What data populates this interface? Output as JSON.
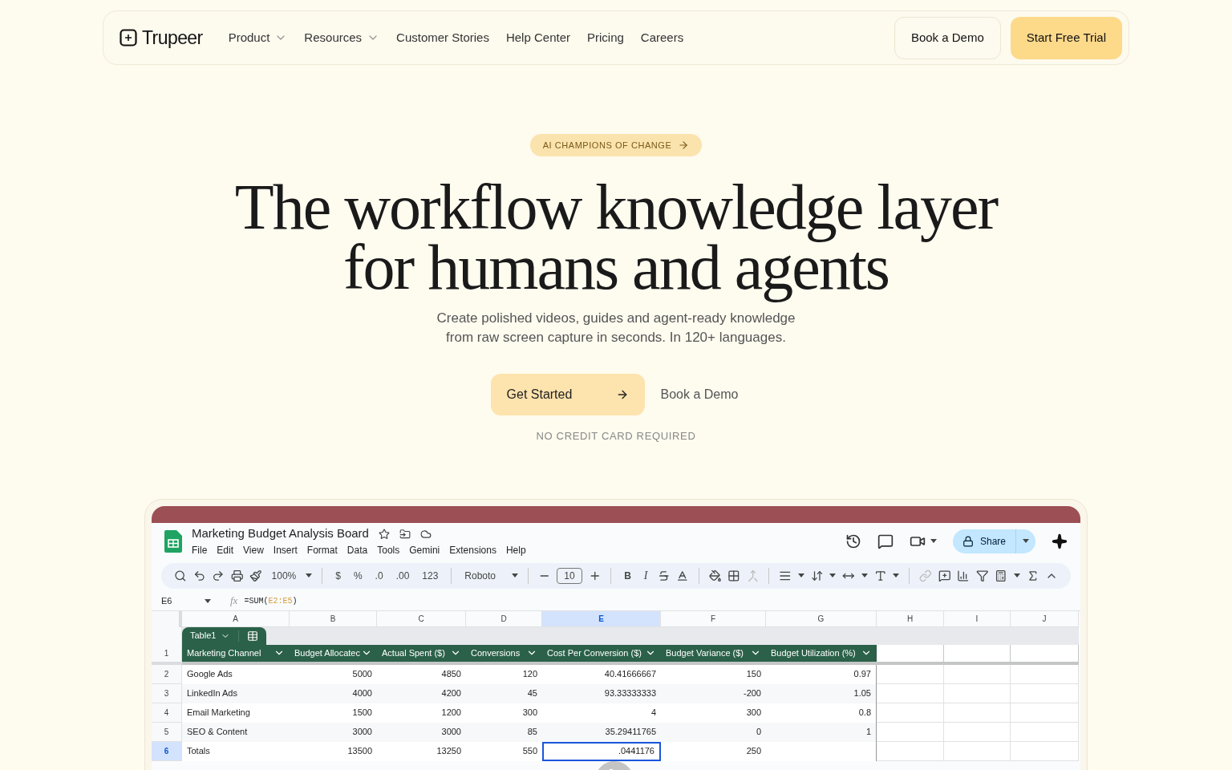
{
  "nav": {
    "logo": "Trupeer",
    "links": [
      {
        "label": "Product",
        "dropdown": true
      },
      {
        "label": "Resources",
        "dropdown": true
      },
      {
        "label": "Customer Stories",
        "dropdown": false
      },
      {
        "label": "Help Center",
        "dropdown": false
      },
      {
        "label": "Pricing",
        "dropdown": false
      },
      {
        "label": "Careers",
        "dropdown": false
      }
    ],
    "buttons": [
      {
        "label": "Book a Demo",
        "kind": "outline"
      },
      {
        "label": "Start Free Trial",
        "kind": "primary"
      }
    ]
  },
  "hero": {
    "badge": "AI CHAMPIONS OF CHANGE",
    "headline": [
      "The workflow knowledge layer",
      "for humans and agents"
    ],
    "subtitle": [
      "Create polished videos, guides and agent-ready knowledge",
      "from raw screen capture in seconds. In 120+ languages."
    ],
    "cta": [
      {
        "label": "Get Started",
        "kind": "primary"
      },
      {
        "label": "Book a Demo",
        "kind": "link"
      }
    ],
    "note": "NO CREDIT CARD REQUIRED"
  },
  "spreadsheet": {
    "title": "Marketing Budget Analysis Board",
    "menus": [
      "File",
      "Edit",
      "View",
      "Insert",
      "Format",
      "Data",
      "Tools",
      "Gemini",
      "Extensions",
      "Help"
    ],
    "share": "Share",
    "toolbar": {
      "zoom": "100%",
      "currency": "$",
      "percent": "%",
      "decrease_decimal": ".0",
      "increase_decimal": ".00",
      "number_format": "123",
      "font": "Roboto",
      "font_size": "10",
      "bold": "B",
      "italic": "I"
    },
    "cell_ref": "E6",
    "function_label": "fx",
    "formula": {
      "prefix": "=SUM(",
      "range": "E2:E5",
      "suffix": ")"
    },
    "columns": [
      {
        "label": "A",
        "selected": false
      },
      {
        "label": "B",
        "selected": false
      },
      {
        "label": "C",
        "selected": false
      },
      {
        "label": "D",
        "selected": false
      },
      {
        "label": "E",
        "selected": true
      },
      {
        "label": "F",
        "selected": false
      },
      {
        "label": "G",
        "selected": false
      },
      {
        "label": "H",
        "selected": false
      },
      {
        "label": "I",
        "selected": false
      },
      {
        "label": "J",
        "selected": false
      }
    ],
    "table_name": "Table1",
    "header": {
      "number": "1",
      "cells": [
        "Marketing Channel",
        "Budget Allocatec",
        "Actual Spent ($)",
        "Conversions",
        "Cost Per Conversion ($)",
        "Budget Variance ($)",
        "Budget Utilization (%)"
      ]
    },
    "rows": [
      {
        "number": "2",
        "selected": false,
        "cells": [
          {
            "value": "Google Ads",
            "selected": false
          },
          {
            "value": "5000",
            "selected": false
          },
          {
            "value": "4850",
            "selected": false
          },
          {
            "value": "120",
            "selected": false
          },
          {
            "value": "40.41666667",
            "selected": false
          },
          {
            "value": "150",
            "selected": false
          },
          {
            "value": "0.97",
            "selected": false
          }
        ]
      },
      {
        "number": "3",
        "selected": false,
        "cells": [
          {
            "value": "LinkedIn Ads",
            "selected": false
          },
          {
            "value": "4000",
            "selected": false
          },
          {
            "value": "4200",
            "selected": false
          },
          {
            "value": "45",
            "selected": false
          },
          {
            "value": "93.33333333",
            "selected": false
          },
          {
            "value": "-200",
            "selected": false
          },
          {
            "value": "1.05",
            "selected": false
          }
        ]
      },
      {
        "number": "4",
        "selected": false,
        "cells": [
          {
            "value": "Email Marketing",
            "selected": false
          },
          {
            "value": "1500",
            "selected": false
          },
          {
            "value": "1200",
            "selected": false
          },
          {
            "value": "300",
            "selected": false
          },
          {
            "value": "4",
            "selected": false
          },
          {
            "value": "300",
            "selected": false
          },
          {
            "value": "0.8",
            "selected": false
          }
        ]
      },
      {
        "number": "5",
        "selected": false,
        "cells": [
          {
            "value": "SEO & Content",
            "selected": false
          },
          {
            "value": "3000",
            "selected": false
          },
          {
            "value": "3000",
            "selected": false
          },
          {
            "value": "85",
            "selected": false
          },
          {
            "value": "35.29411765",
            "selected": false
          },
          {
            "value": "0",
            "selected": false
          },
          {
            "value": "1",
            "selected": false
          }
        ]
      },
      {
        "number": "6",
        "selected": true,
        "cells": [
          {
            "value": "Totals",
            "selected": false
          },
          {
            "value": "13500",
            "selected": false
          },
          {
            "value": "13250",
            "selected": false
          },
          {
            "value": "550",
            "selected": false
          },
          {
            "value": ".0441176",
            "selected": true
          },
          {
            "value": "250",
            "selected": false
          },
          {
            "selected": false
          }
        ]
      }
    ]
  }
}
